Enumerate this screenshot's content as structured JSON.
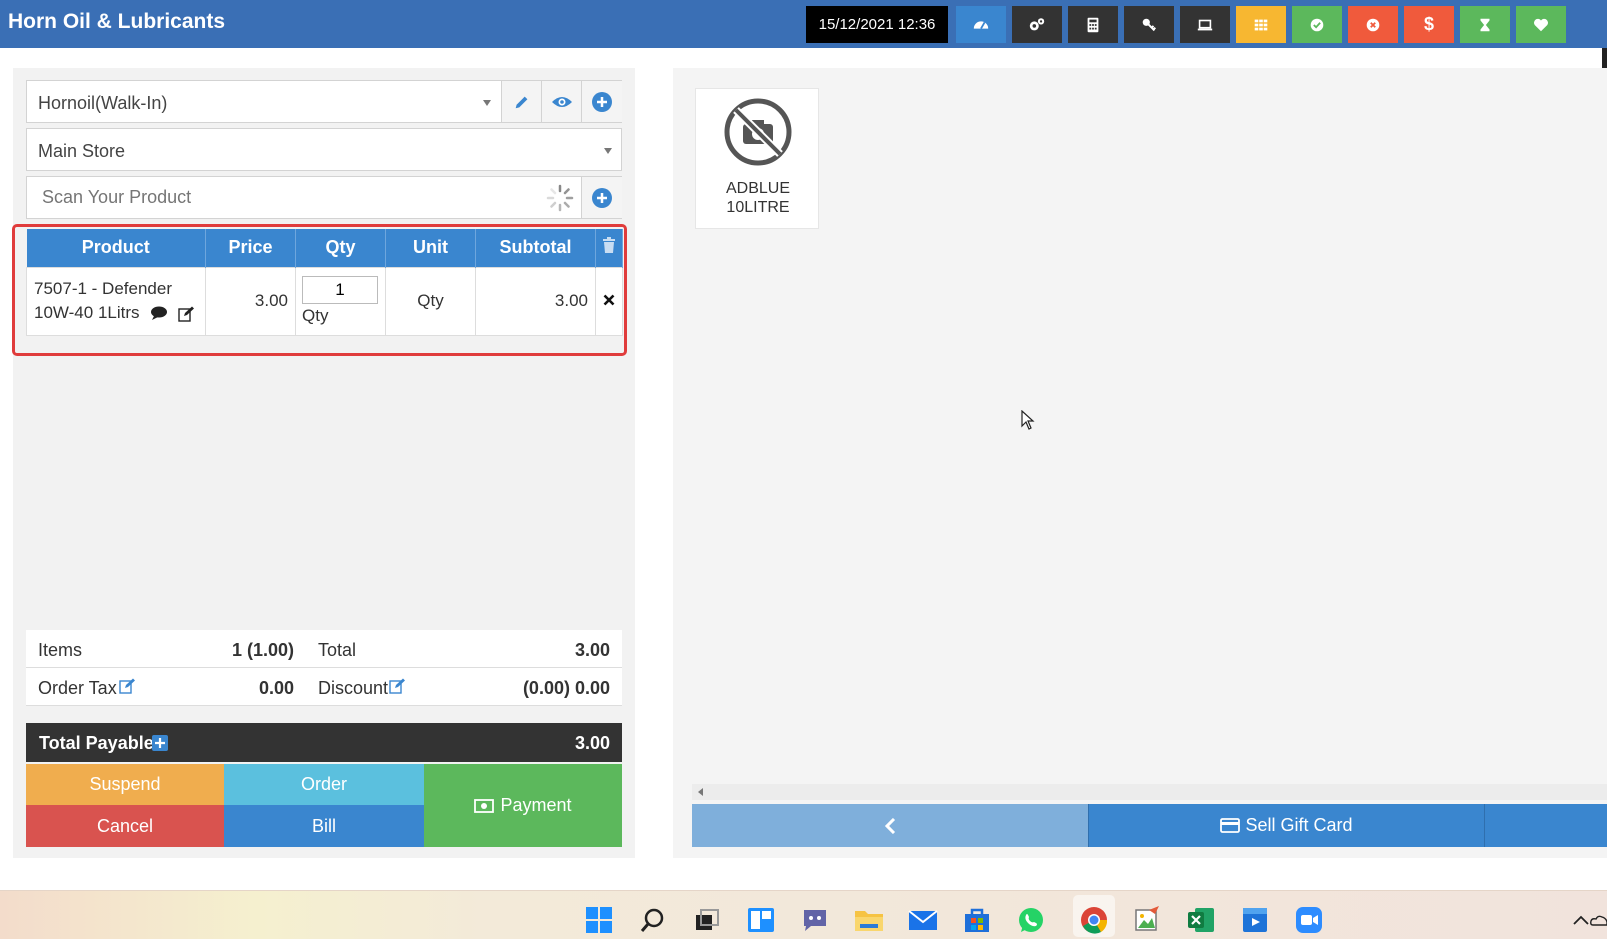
{
  "app": {
    "title": "Horn Oil & Lubricants",
    "datetime": "15/12/2021 12:36"
  },
  "toolbar": [
    {
      "name": "dashboard-icon",
      "color": "#3a86cf"
    },
    {
      "name": "settings-icon",
      "color": "#333333"
    },
    {
      "name": "calculator-icon",
      "color": "#333333"
    },
    {
      "name": "key-icon",
      "color": "#333333"
    },
    {
      "name": "laptop-icon",
      "color": "#333333"
    },
    {
      "name": "grid-icon",
      "color": "#f7b731"
    },
    {
      "name": "check-circle-icon",
      "color": "#5cb85c"
    },
    {
      "name": "close-circle-icon",
      "color": "#f05a3c"
    },
    {
      "name": "dollar-icon",
      "color": "#f05a3c"
    },
    {
      "name": "hourglass-icon",
      "color": "#5cb85c"
    },
    {
      "name": "heart-icon",
      "color": "#5cb85c"
    }
  ],
  "customer": {
    "value": "Hornoil(Walk-In)"
  },
  "warehouse": {
    "value": "Main Store"
  },
  "search": {
    "placeholder": "Scan Your Product"
  },
  "table": {
    "headers": {
      "product": "Product",
      "price": "Price",
      "qty": "Qty",
      "unit": "Unit",
      "subtotal": "Subtotal"
    },
    "rows": [
      {
        "product_line1": "7507-1 - Defender",
        "product_line2": "10W-40 1Litrs",
        "price": "3.00",
        "qty": "1",
        "qty_label": "Qty",
        "unit": "Qty",
        "subtotal": "3.00"
      }
    ]
  },
  "totals": {
    "items_label": "Items",
    "items_value": "1 (1.00)",
    "total_label": "Total",
    "total_value": "3.00",
    "order_tax_label": "Order Tax",
    "order_tax_value": "0.00",
    "discount_label": "Discount",
    "discount_value": "(0.00) 0.00",
    "payable_label": "Total Payable",
    "payable_value": "3.00"
  },
  "actions": {
    "suspend": "Suspend",
    "order": "Order",
    "payment": "Payment",
    "cancel": "Cancel",
    "bill": "Bill"
  },
  "products": [
    {
      "line1": "ADBLUE",
      "line2": "10LITRE"
    }
  ],
  "nav": {
    "sell_gift_card": "Sell Gift Card"
  }
}
